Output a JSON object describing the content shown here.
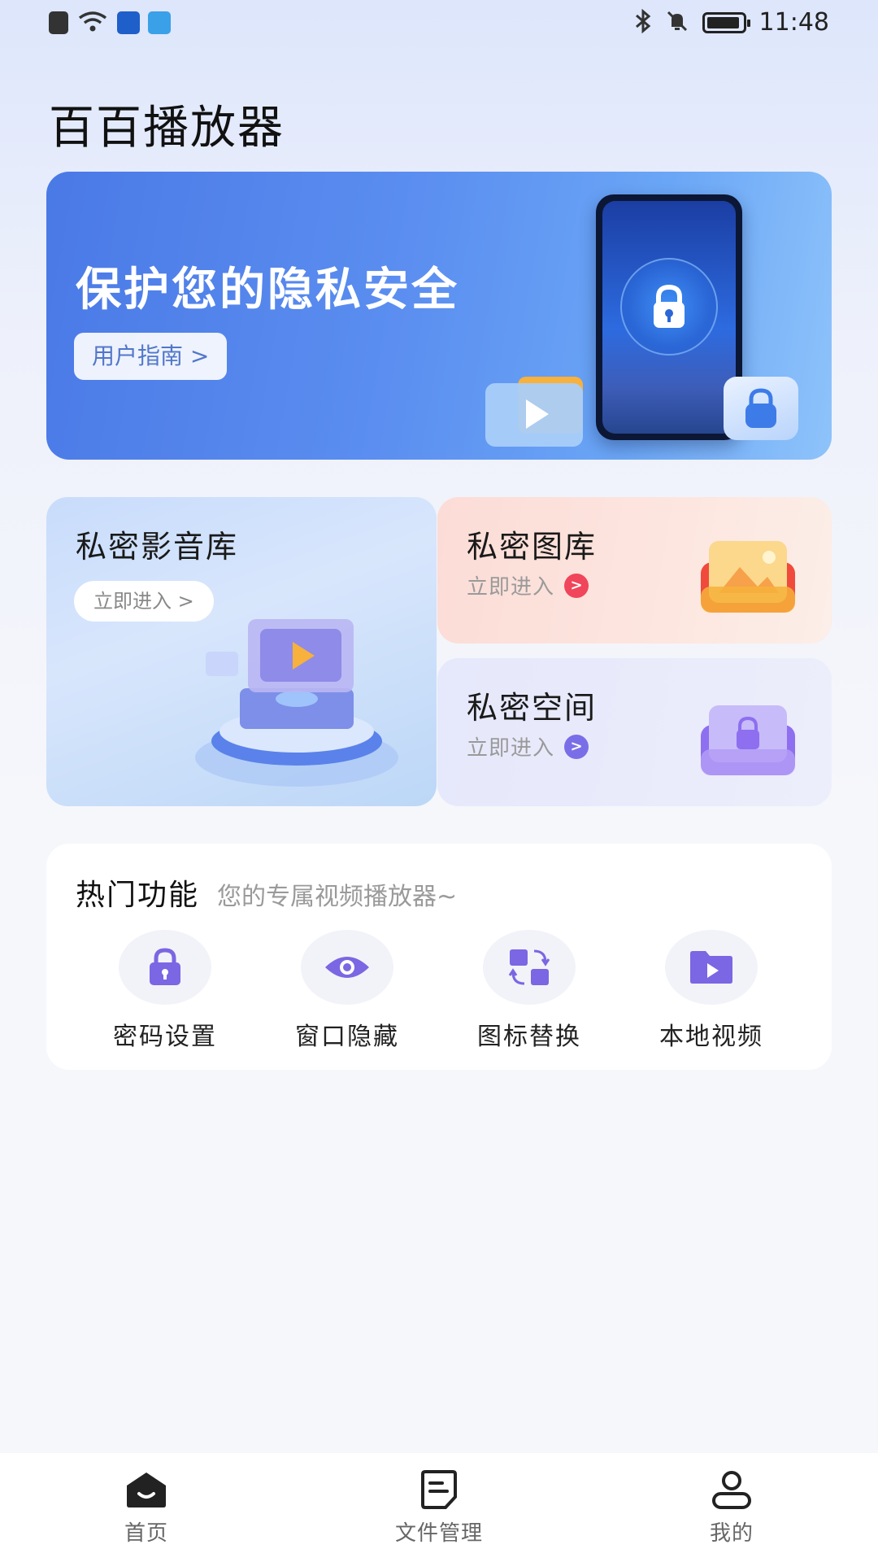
{
  "status_bar": {
    "time": "11:48"
  },
  "app": {
    "title": "百百播放器"
  },
  "banner": {
    "title": "保护您的隐私安全",
    "button": "用户指南 >"
  },
  "cards": {
    "media_library": {
      "title": "私密影音库",
      "button": "立即进入 >"
    },
    "gallery": {
      "title": "私密图库",
      "enter": "立即进入",
      "accent": "#f0455a"
    },
    "space": {
      "title": "私密空间",
      "enter": "立即进入",
      "accent": "#7a6ee8"
    }
  },
  "features": {
    "title": "热门功能",
    "subtitle": "您的专属视频播放器~",
    "items": [
      {
        "label": "密码设置",
        "icon": "lock-icon"
      },
      {
        "label": "窗口隐藏",
        "icon": "eye-icon"
      },
      {
        "label": "图标替换",
        "icon": "swap-icon"
      },
      {
        "label": "本地视频",
        "icon": "video-folder-icon"
      }
    ],
    "accent": "#7b66e3"
  },
  "bottom_nav": [
    {
      "label": "首页",
      "icon": "home-icon",
      "active": true
    },
    {
      "label": "文件管理",
      "icon": "file-icon",
      "active": false
    },
    {
      "label": "我的",
      "icon": "user-icon",
      "active": false
    }
  ]
}
